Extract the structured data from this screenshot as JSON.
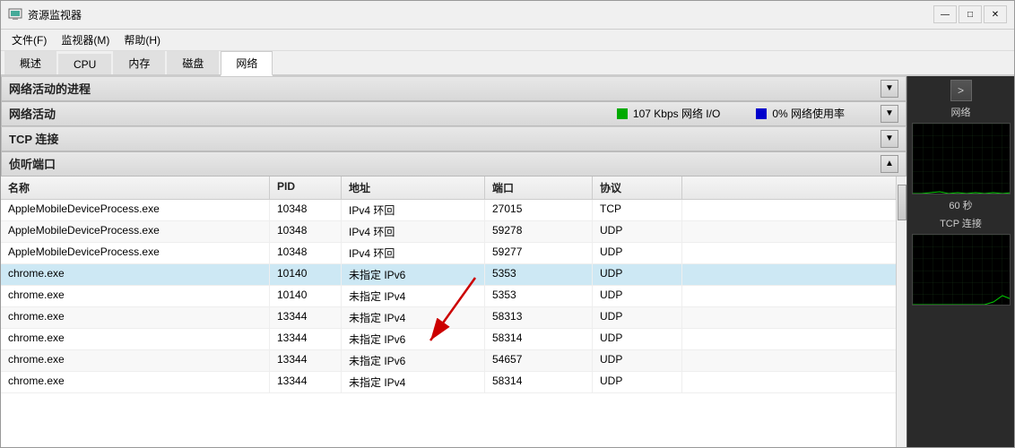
{
  "window": {
    "title": "资源监视器",
    "icon": "monitor-icon"
  },
  "menu": {
    "items": [
      {
        "label": "文件(F)"
      },
      {
        "label": "监视器(M)"
      },
      {
        "label": "帮助(H)"
      }
    ]
  },
  "tabs": [
    {
      "label": "概述",
      "active": false
    },
    {
      "label": "CPU",
      "active": false
    },
    {
      "label": "内存",
      "active": false
    },
    {
      "label": "磁盘",
      "active": false
    },
    {
      "label": "网络",
      "active": true
    }
  ],
  "sections": {
    "network_processes": {
      "title": "网络活动的进程",
      "collapsed": false
    },
    "network_activity": {
      "title": "网络活动",
      "stat1_label": "107 Kbps 网络 I/O",
      "stat2_label": "0% 网络使用率",
      "stat1_color": "#00aa00",
      "stat2_color": "#0000cc"
    },
    "tcp_connections": {
      "title": "TCP 连接",
      "collapsed": false
    },
    "listening_ports": {
      "title": "侦听端口",
      "expanded": true
    }
  },
  "table": {
    "columns": [
      {
        "label": "名称"
      },
      {
        "label": "PID"
      },
      {
        "label": "地址"
      },
      {
        "label": "端口"
      },
      {
        "label": "协议"
      }
    ],
    "rows": [
      {
        "name": "AppleMobileDeviceProcess.exe",
        "pid": "10348",
        "address": "IPv4 环回",
        "port": "27015",
        "protocol": "TCP",
        "highlight": false
      },
      {
        "name": "AppleMobileDeviceProcess.exe",
        "pid": "10348",
        "address": "IPv4 环回",
        "port": "59278",
        "protocol": "UDP",
        "highlight": false
      },
      {
        "name": "AppleMobileDeviceProcess.exe",
        "pid": "10348",
        "address": "IPv4 环回",
        "port": "59277",
        "protocol": "UDP",
        "highlight": false
      },
      {
        "name": "chrome.exe",
        "pid": "10140",
        "address": "未指定 IPv6",
        "port": "5353",
        "protocol": "UDP",
        "highlight": true
      },
      {
        "name": "chrome.exe",
        "pid": "10140",
        "address": "未指定 IPv4",
        "port": "5353",
        "protocol": "UDP",
        "highlight": false
      },
      {
        "name": "chrome.exe",
        "pid": "13344",
        "address": "未指定 IPv4",
        "port": "58313",
        "protocol": "UDP",
        "highlight": false
      },
      {
        "name": "chrome.exe",
        "pid": "13344",
        "address": "未指定 IPv6",
        "port": "58314",
        "protocol": "UDP",
        "highlight": false
      },
      {
        "name": "chrome.exe",
        "pid": "13344",
        "address": "未指定 IPv6",
        "port": "54657",
        "protocol": "UDP",
        "highlight": false
      },
      {
        "name": "chrome.exe",
        "pid": "13344",
        "address": "未指定 IPv4",
        "port": "58314",
        "protocol": "UDP",
        "highlight": false
      }
    ]
  },
  "sidebar": {
    "nav_label": ">",
    "chart1_label": "网络",
    "time_label": "60 秒",
    "chart2_label": "TCP 连接"
  },
  "title_controls": {
    "minimize": "—",
    "maximize": "□",
    "close": "✕"
  }
}
